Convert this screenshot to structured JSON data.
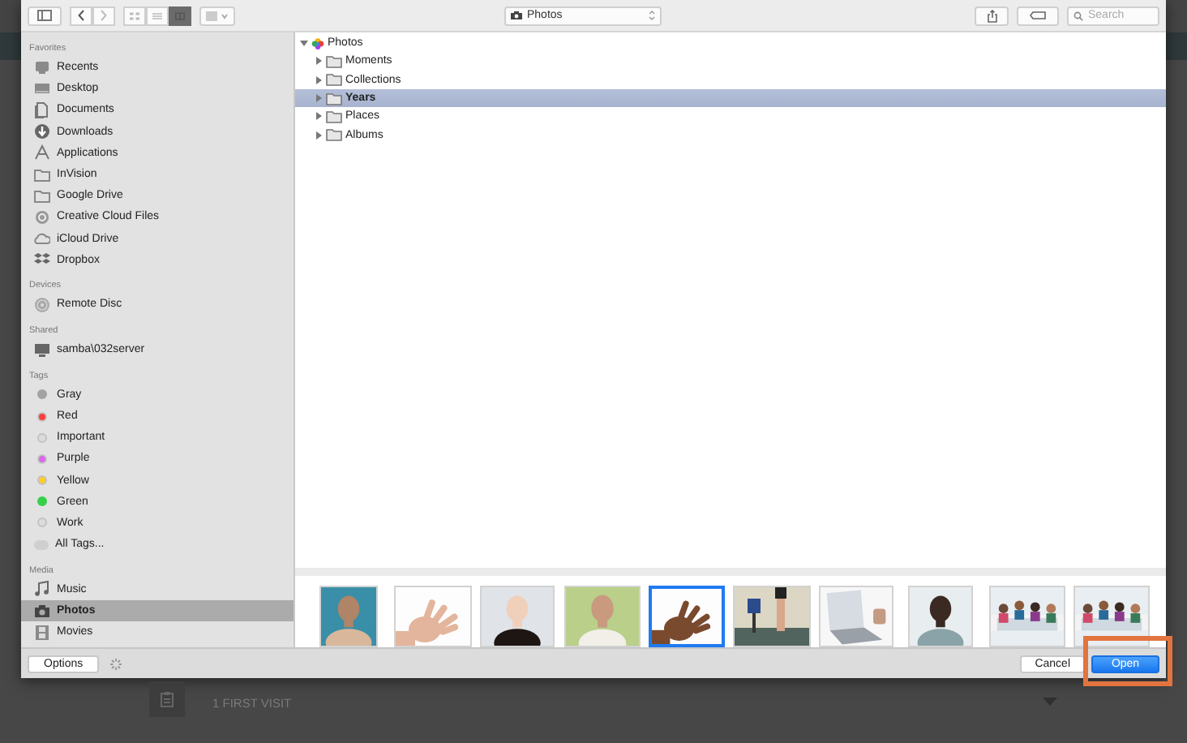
{
  "toolbar": {
    "view_modes": [
      {
        "selected": false
      },
      {
        "selected": false
      },
      {
        "selected": true
      }
    ],
    "location": "Photos",
    "search": {
      "placeholder": "Search"
    }
  },
  "sidebar": {
    "sections": [
      {
        "title": "Favorites",
        "items": [
          {
            "label": "Recents",
            "kind": "place",
            "selected": false
          },
          {
            "label": "Desktop",
            "kind": "place",
            "selected": false
          },
          {
            "label": "Documents",
            "kind": "place",
            "selected": false
          },
          {
            "label": "Downloads",
            "kind": "place",
            "selected": false
          },
          {
            "label": "Applications",
            "kind": "place",
            "selected": false
          },
          {
            "label": "InVision",
            "kind": "place",
            "selected": false
          },
          {
            "label": "Google Drive",
            "kind": "place",
            "selected": false
          },
          {
            "label": "Creative Cloud Files",
            "kind": "place",
            "selected": false
          },
          {
            "label": "iCloud Drive",
            "kind": "place",
            "selected": false
          },
          {
            "label": "Dropbox",
            "kind": "place",
            "selected": false
          }
        ]
      },
      {
        "title": "Devices",
        "items": [
          {
            "label": "Remote Disc",
            "kind": "place",
            "selected": false
          }
        ]
      },
      {
        "title": "Shared",
        "items": [
          {
            "label": "samba\\032server",
            "kind": "place",
            "selected": false
          }
        ]
      },
      {
        "title": "Tags",
        "items": [
          {
            "label": "Gray",
            "kind": "tag",
            "color": "#a3a3a3",
            "selected": false
          },
          {
            "label": "Red",
            "kind": "tag",
            "color": "#fc3d39",
            "selected": false
          },
          {
            "label": "Important",
            "kind": "tag",
            "color": "#dcdcdc",
            "selected": false
          },
          {
            "label": "Purple",
            "kind": "tag",
            "color": "#d869e8",
            "selected": false
          },
          {
            "label": "Yellow",
            "kind": "tag",
            "color": "#fecb2f",
            "selected": false
          },
          {
            "label": "Green",
            "kind": "tag",
            "color": "#35d04a",
            "selected": false
          },
          {
            "label": "Work",
            "kind": "tag",
            "color": "#dcdcdc",
            "selected": false
          },
          {
            "label": "All Tags...",
            "kind": "all-tags",
            "selected": false
          }
        ]
      },
      {
        "title": "Media",
        "items": [
          {
            "label": "Music",
            "kind": "place",
            "selected": false
          },
          {
            "label": "Photos",
            "kind": "place",
            "selected": true
          },
          {
            "label": "Movies",
            "kind": "place",
            "selected": false
          }
        ]
      }
    ]
  },
  "browser": {
    "tree": [
      {
        "label": "Photos",
        "expanded": true,
        "selected": false,
        "children": [
          {
            "label": "Moments",
            "expanded": false,
            "selected": false
          },
          {
            "label": "Collections",
            "expanded": false,
            "selected": false
          },
          {
            "label": "Years",
            "expanded": false,
            "selected": true
          },
          {
            "label": "Places",
            "expanded": false,
            "selected": false
          },
          {
            "label": "Albums",
            "expanded": false,
            "selected": false
          }
        ]
      }
    ],
    "thumbnails": [
      {
        "kind": "picture",
        "selected": false
      },
      {
        "kind": "picture",
        "selected": false
      },
      {
        "kind": "picture",
        "selected": false
      },
      {
        "kind": "picture",
        "selected": false
      },
      {
        "kind": "picture",
        "selected": true
      },
      {
        "kind": "picture",
        "selected": false
      },
      {
        "kind": "picture",
        "selected": false
      },
      {
        "kind": "picture",
        "selected": false
      },
      {
        "kind": "picture",
        "selected": false
      },
      {
        "kind": "picture",
        "selected": false
      }
    ]
  },
  "footer": {
    "options_button": "Options",
    "cancel_button": "Cancel",
    "open_button": "Open",
    "open_highlighted": true
  },
  "background": {
    "step_label": "1 FIRST VISIT"
  }
}
